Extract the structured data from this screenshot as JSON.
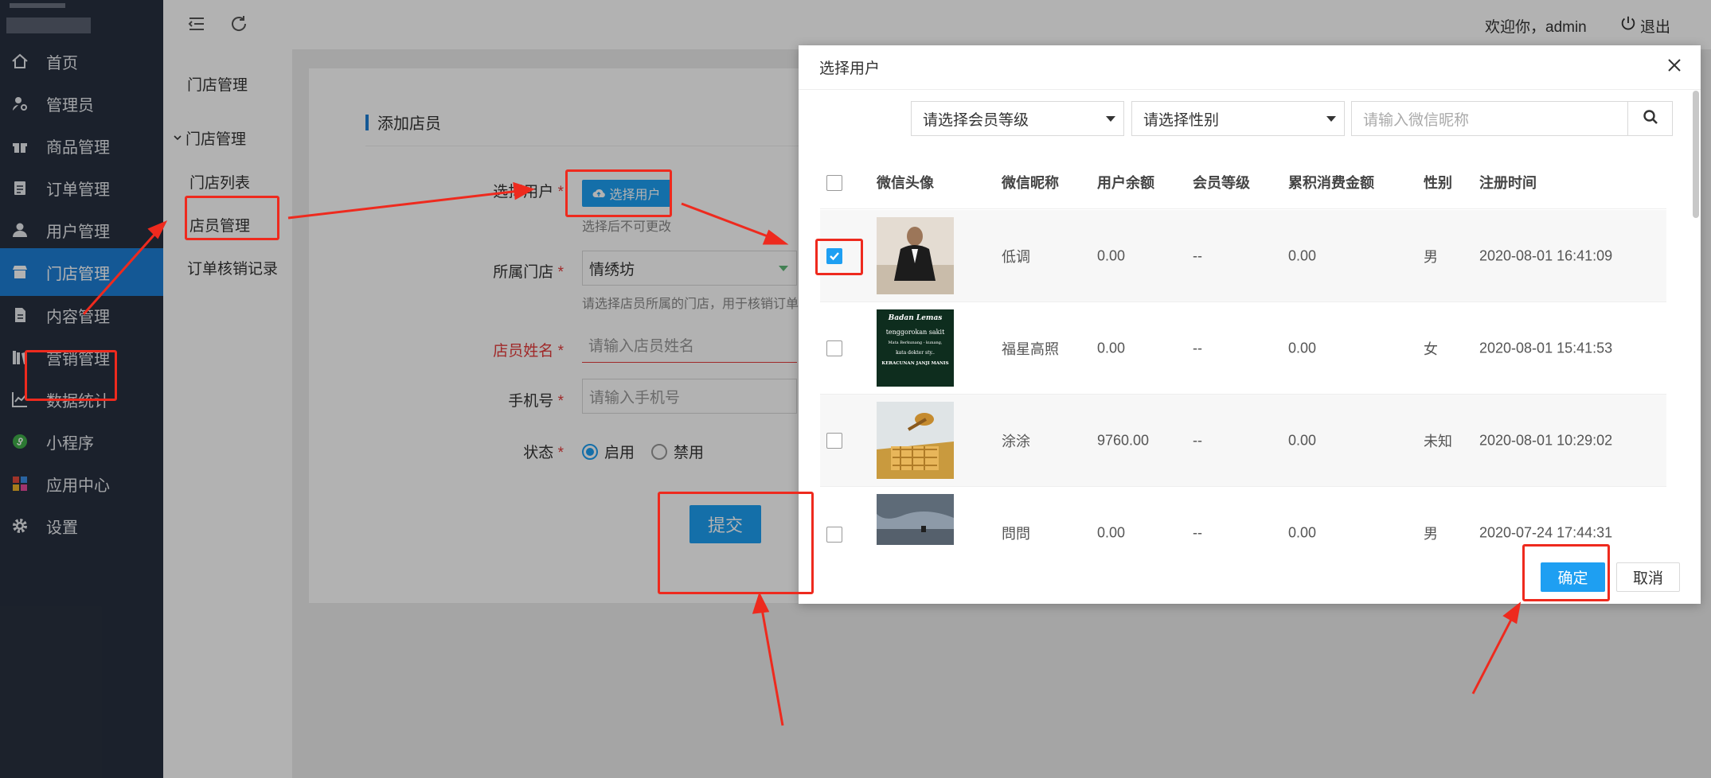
{
  "header": {
    "welcome": "欢迎你，admin",
    "logout": "退出"
  },
  "sidebar": {
    "items": [
      {
        "label": "首页",
        "icon": "home-icon"
      },
      {
        "label": "管理员",
        "icon": "admin-user-icon"
      },
      {
        "label": "商品管理",
        "icon": "gift-icon"
      },
      {
        "label": "订单管理",
        "icon": "clipboard-icon"
      },
      {
        "label": "用户管理",
        "icon": "user-icon"
      },
      {
        "label": "门店管理",
        "icon": "store-icon"
      },
      {
        "label": "内容管理",
        "icon": "document-icon"
      },
      {
        "label": "营销管理",
        "icon": "books-icon"
      },
      {
        "label": "数据统计",
        "icon": "line-chart-icon"
      },
      {
        "label": "小程序",
        "icon": "mini-program-icon"
      },
      {
        "label": "应用中心",
        "icon": "apps-icon"
      },
      {
        "label": "设置",
        "icon": "gear-icon"
      }
    ],
    "active_index": 5
  },
  "subnav": {
    "title": "门店管理",
    "group": "门店管理",
    "items": [
      "门店列表",
      "店员管理",
      "订单核销记录"
    ]
  },
  "form": {
    "section_title": "添加店员",
    "select_user_label": "选择用户",
    "select_user_button": "选择用户",
    "select_user_hint": "选择后不可更改",
    "store_label": "所属门店",
    "store_value": "情绣坊",
    "store_hint": "请选择店员所属的门店，用于核销订单",
    "name_label": "店员姓名",
    "name_placeholder": "请输入店员姓名",
    "phone_label": "手机号",
    "phone_placeholder": "请输入手机号",
    "status_label": "状态",
    "status_on": "启用",
    "status_off": "禁用",
    "submit": "提交"
  },
  "modal": {
    "title": "选择用户",
    "level_select": "请选择会员等级",
    "gender_select": "请选择性别",
    "nickname_placeholder": "请输入微信昵称",
    "columns": [
      "微信头像",
      "微信昵称",
      "用户余额",
      "会员等级",
      "累积消费金额",
      "性别",
      "注册时间"
    ],
    "rows": [
      {
        "nickname": "低调",
        "balance": "0.00",
        "level": "--",
        "spent": "0.00",
        "gender": "男",
        "registered": "2020-08-01 16:41:09",
        "checked": true
      },
      {
        "nickname": "福星高照",
        "balance": "0.00",
        "level": "--",
        "spent": "0.00",
        "gender": "女",
        "registered": "2020-08-01 15:41:53",
        "checked": false
      },
      {
        "nickname": "涂涂",
        "balance": "9760.00",
        "level": "--",
        "spent": "0.00",
        "gender": "未知",
        "registered": "2020-08-01 10:29:02",
        "checked": false
      },
      {
        "nickname": "問問",
        "balance": "0.00",
        "level": "--",
        "spent": "0.00",
        "gender": "男",
        "registered": "2020-07-24 17:44:31",
        "checked": false
      }
    ],
    "confirm": "确定",
    "cancel": "取消"
  },
  "thumb2_text": {
    "line1": "Badan Lemas",
    "line2": "tenggorokan sakit",
    "line3": "Mata Berkunang - kunang,",
    "line4": "kata dokter sty..",
    "line5": "KERACUNAN JANJI MANIS"
  },
  "colors": {
    "sidebar": "#28303f",
    "active": "#1e7ed6",
    "primary": "#1e9ff2",
    "annotation": "#ee2a1e"
  }
}
